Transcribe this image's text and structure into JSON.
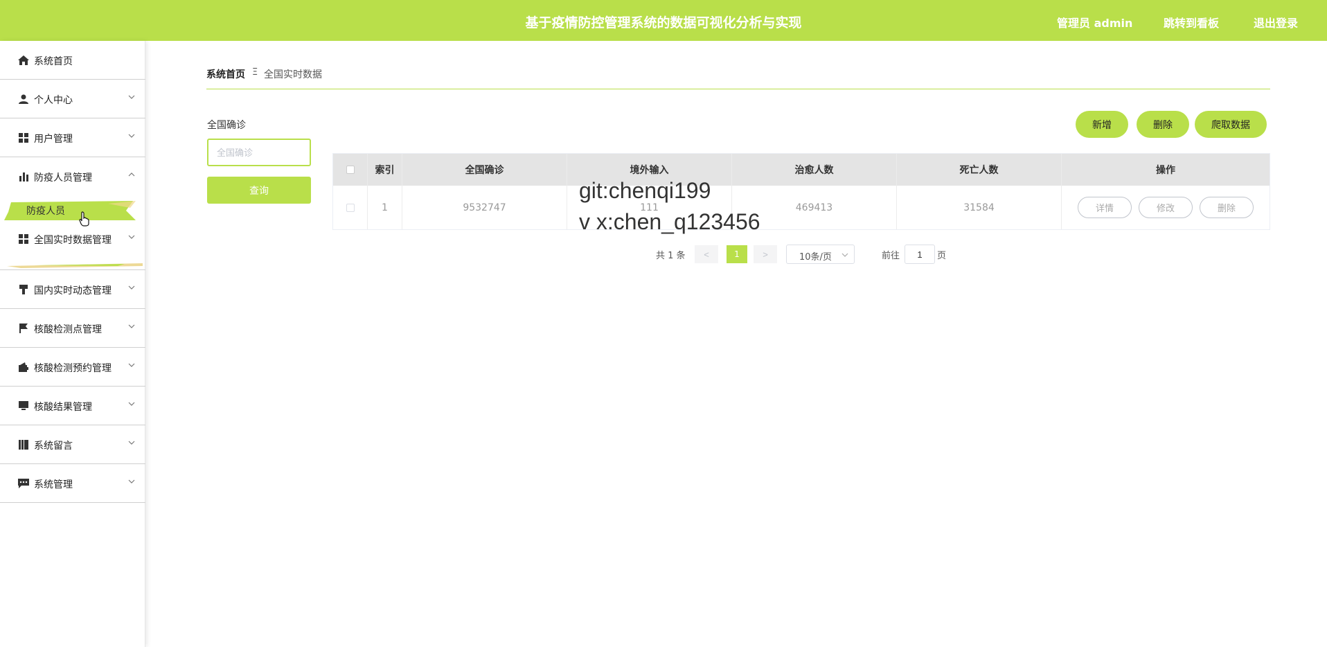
{
  "header": {
    "title": "基于疫情防控管理系统的数据可视化分析与实现",
    "admin_label": "管理员 admin",
    "dashboard_link": "跳转到看板",
    "logout_link": "退出登录"
  },
  "sidebar": {
    "items": [
      {
        "label": "系统首页",
        "icon": "home-icon"
      },
      {
        "label": "个人中心",
        "icon": "user-icon"
      },
      {
        "label": "用户管理",
        "icon": "grid-icon"
      },
      {
        "label": "防疫人员管理",
        "icon": "bar-chart-icon"
      },
      {
        "label": "全国实时数据管理",
        "icon": "grid-icon"
      },
      {
        "label": "国内实时动态管理",
        "icon": "brush-icon"
      },
      {
        "label": "核酸检测点管理",
        "icon": "flag-icon"
      },
      {
        "label": "核酸检测预约管理",
        "icon": "wallet-icon"
      },
      {
        "label": "核酸结果管理",
        "icon": "monitor-icon"
      },
      {
        "label": "系统留言",
        "icon": "book-icon"
      },
      {
        "label": "系统管理",
        "icon": "message-icon"
      }
    ],
    "active_submenu": "防疫人员"
  },
  "breadcrumb": {
    "home": "系统首页",
    "separator": "Ξ",
    "current": "全国实时数据"
  },
  "search": {
    "label": "全国确诊",
    "placeholder": "全国确诊",
    "query_button": "查询"
  },
  "actions": {
    "add": "新增",
    "delete": "删除",
    "crawl": "爬取数据"
  },
  "table": {
    "headers": [
      "索引",
      "全国确诊",
      "境外输入",
      "治愈人数",
      "死亡人数",
      "操作"
    ],
    "rows": [
      {
        "index": "1",
        "confirmed": "9532747",
        "imported": "111",
        "cured": "469413",
        "deaths": "31584"
      }
    ],
    "row_actions": {
      "detail": "详情",
      "edit": "修改",
      "delete": "删除"
    }
  },
  "watermark": {
    "line1": "git:chenqi199",
    "line2": "v x:chen_q123456"
  },
  "pagination": {
    "total": "共 1 条",
    "prev": "<",
    "current_page": "1",
    "next": ">",
    "page_size": "10条/页",
    "goto_label": "前往",
    "goto_value": "1",
    "goto_suffix": "页"
  },
  "colors": {
    "accent": "#b9df4a"
  }
}
